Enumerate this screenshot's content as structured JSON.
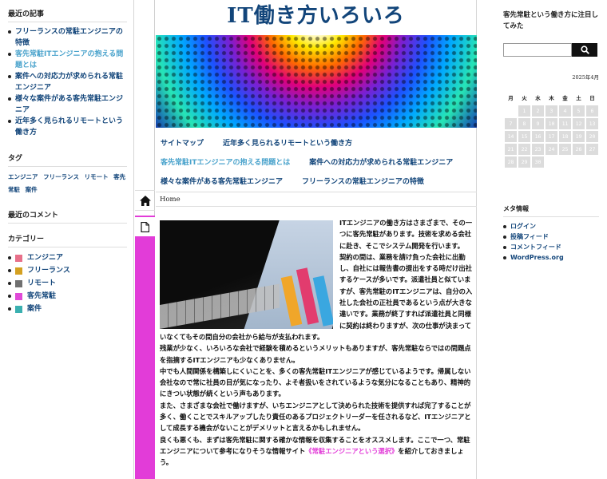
{
  "left": {
    "recent_posts_title": "最近の記事",
    "recent_posts": [
      "フリーランスの常駐エンジニアの特徴",
      "客先常駐ITエンジニアの抱える問題とは",
      "案件への対応力が求められる常駐エンジニア",
      "様々な案件がある客先常駐エンジニア",
      "近年多く見られるリモートという働き方"
    ],
    "tags_title": "タグ",
    "tags": "エンジニア フリーランス リモート 客先常駐 案件",
    "recent_comments_title": "最近のコメント",
    "categories_title": "カテゴリー",
    "categories": [
      {
        "label": "エンジニア",
        "color": "#e8708a"
      },
      {
        "label": "フリーランス",
        "color": "#d4a020"
      },
      {
        "label": "リモート",
        "color": "#707070"
      },
      {
        "label": "客先常駐",
        "color": "#e04ad8"
      },
      {
        "label": "案件",
        "color": "#3ab0b0"
      }
    ]
  },
  "icons": {
    "home": "home-icon",
    "page": "document-icon",
    "search": "search-icon"
  },
  "main": {
    "site_title": "IT働き方いろいろ",
    "nav": [
      [
        "サイトマップ",
        "近年多く見られるリモートという働き方"
      ],
      [
        "客先常駐ITエンジニアの抱える問題とは",
        "案件への対応力が求められる常駐エンジニア"
      ],
      [
        "様々な案件がある客先常駐エンジニア",
        "フリーランスの常駐エンジニアの特徴"
      ]
    ],
    "breadcrumb": "Home",
    "accent_color": "#e23cd8",
    "article": {
      "p1": "ITエンジニアの働き方はさまざまで、その一つに客先常駐があります。技術を求める会社に赴き、そこでシステム開発を行います。",
      "p2": "契約の間は、業務を請け負った会社に出勤し、自社には報告書の提出をする時だけ出社するケースが多いです。派遣社員と似ていますが、客先常駐のITエンジニアは、自分の入社した会社の正社員であるという点が大きな違いです。業務が終了すれば派遣社員と同様に契約は終わりますが、次の仕事が決まっていなくてもその間自分の会社から給与が支払われます。",
      "p3": "残業が少なく、いろいろな会社で経験を積めるというメリットもありますが、客先常駐ならではの問題点を指摘するITエンジニアも少なくありません。",
      "p4": "中でも人間関係を構築しにくいことを、多くの客先常駐ITエンジニアが感じているようです。帰属しない会社なので常に社員の目が気になったり、よそ者扱いをされているような気分になることもあり、精神的にきつい状態が続くという声もあります。",
      "p5": "また、さまざまな会社で働けますが、いちエンジニアとして決められた技術を提供すれば完了することが多く、働くことでスキルアップしたり責任のあるプロジェクトリーダーを任されるなど、ITエンジニアとして成長する機会がないことがデメリットと言えるかもしれません。",
      "p6_before": "良くも悪くも、まずは客先常駐に関する確かな情報を収集することをオススメします。ここで一つ、常駐エンジニアについて参考になりそうな情報サイト",
      "p6_link": "《常駐エンジニアという選択》",
      "p6_after": "を紹介しておきましょう。"
    }
  },
  "right": {
    "heading": "客先常駐という働き方に注目してみた",
    "calendar_caption": "2025年4月",
    "weekdays": [
      "月",
      "火",
      "水",
      "木",
      "金",
      "土",
      "日"
    ],
    "weeks": [
      [
        "",
        "1",
        "2",
        "3",
        "4",
        "5",
        "6"
      ],
      [
        "7",
        "8",
        "9",
        "10",
        "11",
        "12",
        "13"
      ],
      [
        "14",
        "15",
        "16",
        "17",
        "18",
        "19",
        "20"
      ],
      [
        "21",
        "22",
        "23",
        "24",
        "25",
        "26",
        "27"
      ],
      [
        "28",
        "29",
        "30",
        "",
        "",
        "",
        ""
      ]
    ],
    "meta_title": "メタ情報",
    "meta_links": [
      "ログイン",
      "投稿フィード",
      "コメントフィード",
      "WordPress.org"
    ]
  }
}
